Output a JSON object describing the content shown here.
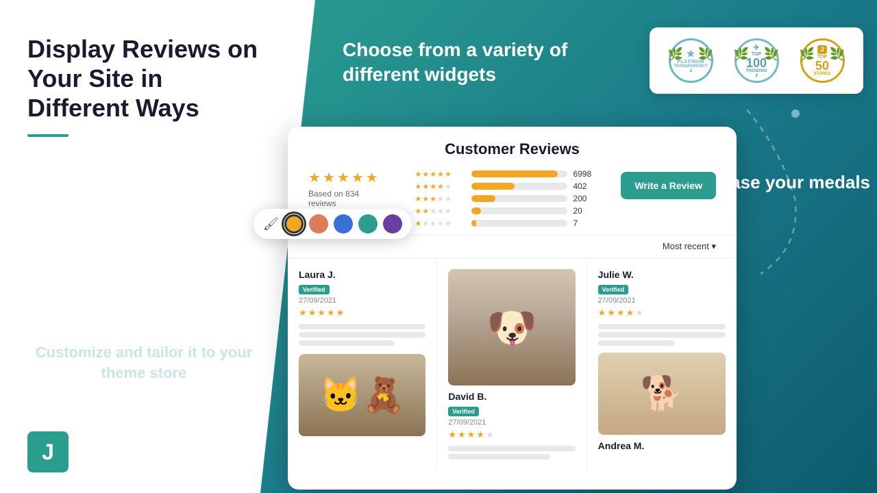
{
  "page": {
    "title": "Display Reviews on Your Site in Different Ways",
    "subtitle_underline": true,
    "choose_text": "Choose from a variety of\ndifferent widgets",
    "customize_text": "Customize and\ntailor it to your\ntheme store",
    "showcase_text": "Showcase\nyour medals",
    "j_logo": "J"
  },
  "badges": [
    {
      "id": "platinum",
      "line1": "PLATINUM",
      "line2": "TRANSPARENCY",
      "icon": "★",
      "color": "#6ab4c8",
      "border_color": "#6ab4c8"
    },
    {
      "id": "top100",
      "line1": "TOP",
      "line2": "100",
      "line3": "TRENDING",
      "icon": "✈",
      "color": "#5a9db0",
      "border_color": "#7ab8c8"
    },
    {
      "id": "top50",
      "line1": "TOP",
      "line2": "50",
      "line3": "STORES",
      "icon": "J",
      "color": "#d4a017",
      "border_color": "#d4a017"
    }
  ],
  "colors": {
    "brush_icon": "🖌",
    "swatches": [
      {
        "color": "#f4a623",
        "active": true
      },
      {
        "color": "#e07b5a",
        "active": false
      },
      {
        "color": "#3a6fd8",
        "active": false
      },
      {
        "color": "#2a9d8f",
        "active": false
      },
      {
        "color": "#6a3fa0",
        "active": false
      }
    ]
  },
  "widget": {
    "title": "Customer Reviews",
    "rating_summary": {
      "overall_stars": 4.5,
      "based_on": "Based on 834 reviews",
      "bars": [
        {
          "stars": 5,
          "count": 6998,
          "percent": 90
        },
        {
          "stars": 4,
          "count": 402,
          "percent": 45
        },
        {
          "stars": 3,
          "count": 200,
          "percent": 25
        },
        {
          "stars": 2,
          "count": 20,
          "percent": 10
        },
        {
          "stars": 1,
          "count": 7,
          "percent": 5
        }
      ],
      "write_review_label": "Write a Review"
    },
    "sort": {
      "label": "Most recent",
      "icon": "▾"
    },
    "reviews": [
      {
        "name": "Laura J.",
        "verified": true,
        "verified_label": "Verified",
        "date": "27/09/2021",
        "stars": 5,
        "lines": [
          3,
          2,
          2
        ],
        "image": null
      },
      {
        "name": "David B.",
        "verified": true,
        "verified_label": "Verified",
        "date": "27/09/2021",
        "stars": 4,
        "lines": [
          2,
          2
        ],
        "image": "dog"
      },
      {
        "name": "Julie W.",
        "verified": true,
        "verified_label": "Verified",
        "date": "27/09/2021",
        "stars": 4,
        "lines": [
          3,
          2
        ],
        "image": "dog2"
      },
      {
        "name": "Andrea M.",
        "lines": [
          2
        ],
        "image": "cat"
      }
    ]
  }
}
